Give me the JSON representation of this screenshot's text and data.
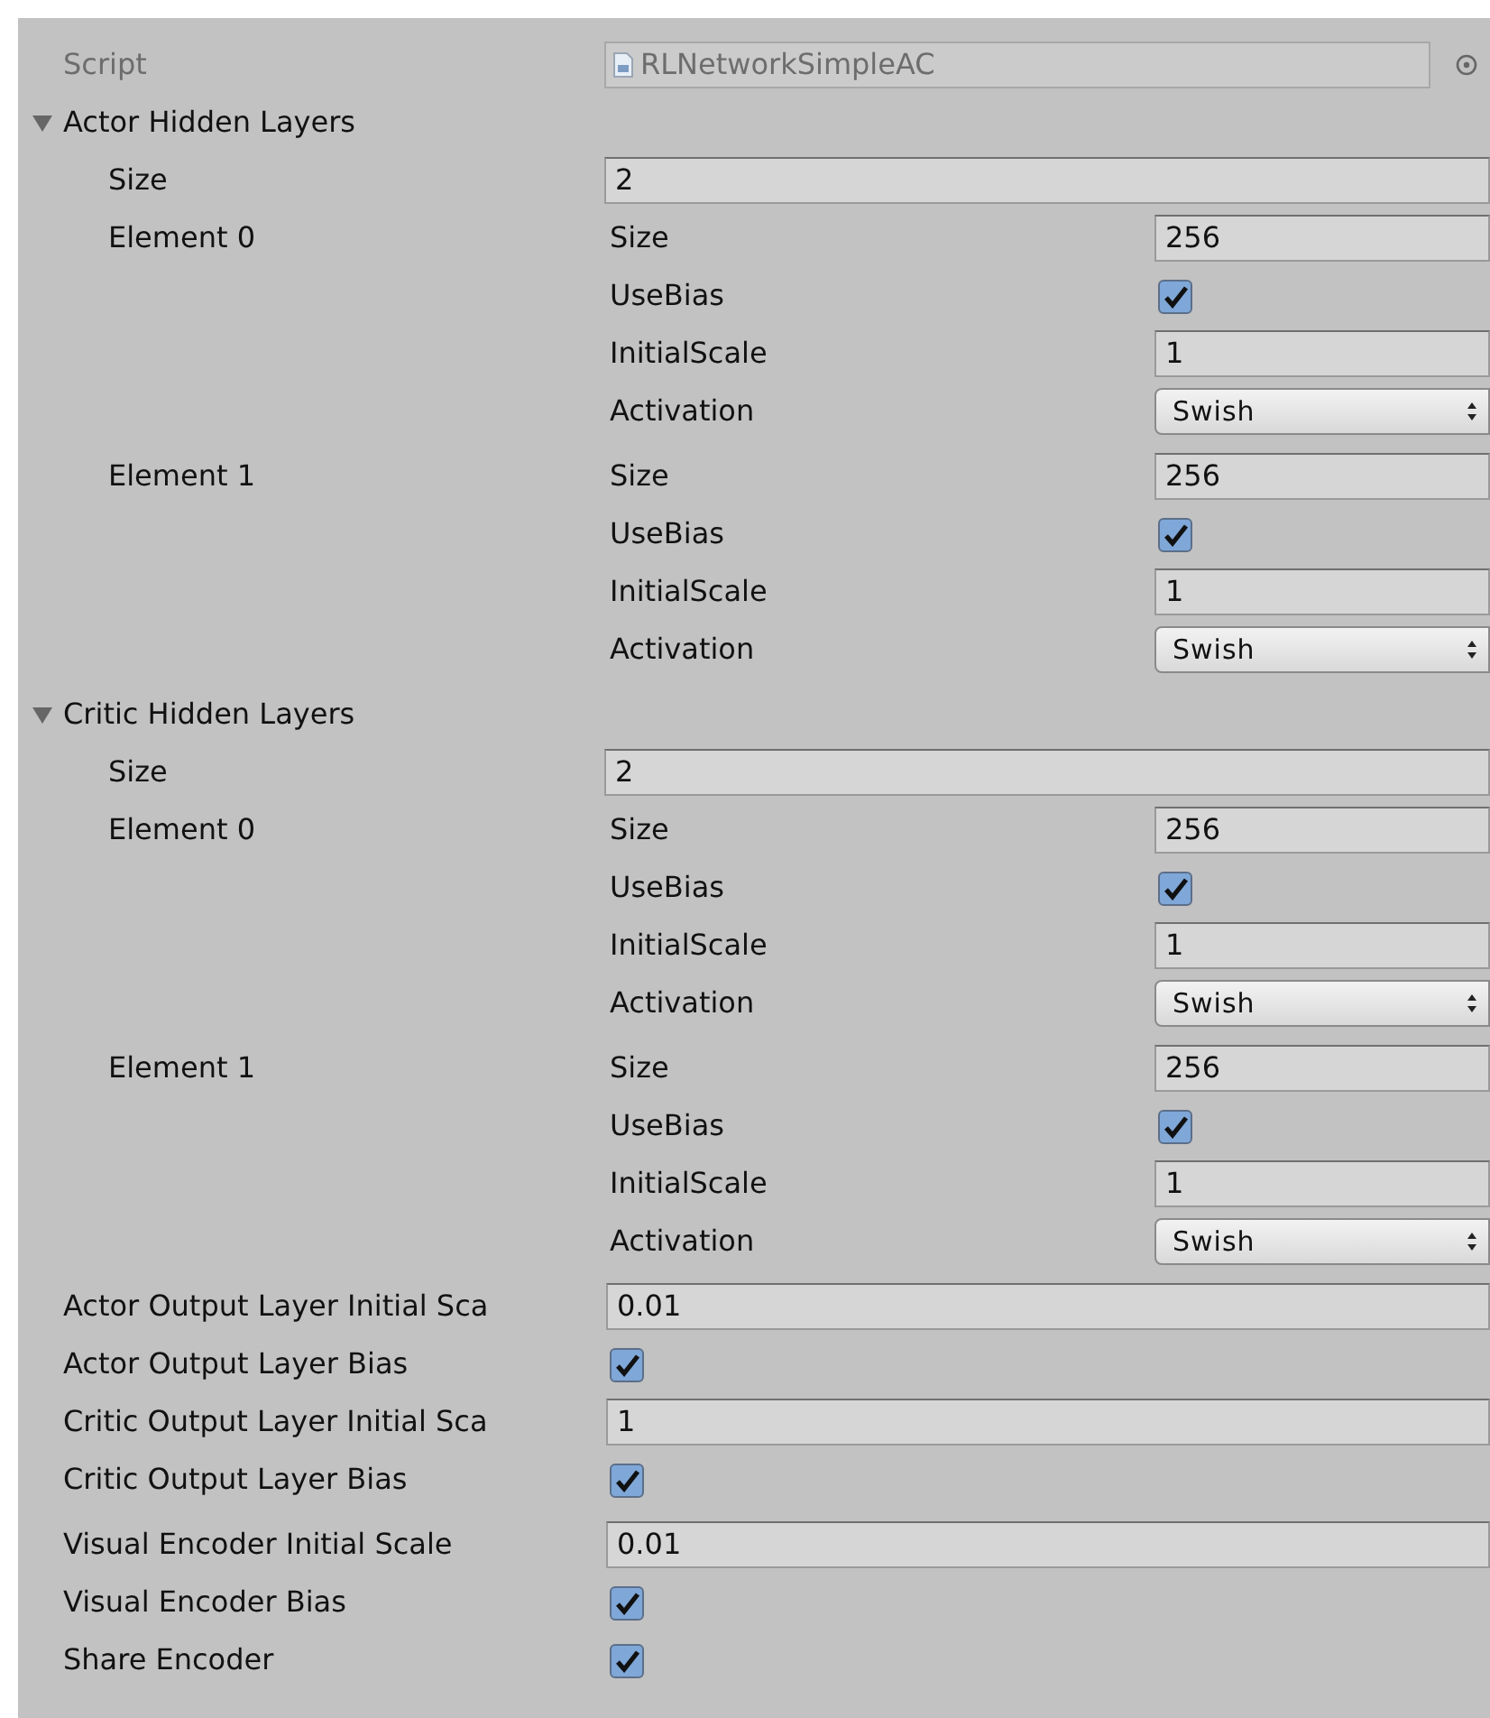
{
  "script": {
    "label": "Script",
    "value": "RLNetworkSimpleAC"
  },
  "sections": [
    {
      "title": "Actor Hidden Layers",
      "expanded": true,
      "size_label": "Size",
      "size": "2",
      "elements": [
        {
          "label": "Element 0",
          "fields": [
            {
              "kind": "number",
              "label": "Size",
              "value": "256"
            },
            {
              "kind": "checkbox",
              "label": "UseBias",
              "checked": true
            },
            {
              "kind": "number",
              "label": "InitialScale",
              "value": "1"
            },
            {
              "kind": "dropdown",
              "label": "Activation",
              "value": "Swish"
            }
          ]
        },
        {
          "label": "Element 1",
          "fields": [
            {
              "kind": "number",
              "label": "Size",
              "value": "256"
            },
            {
              "kind": "checkbox",
              "label": "UseBias",
              "checked": true
            },
            {
              "kind": "number",
              "label": "InitialScale",
              "value": "1"
            },
            {
              "kind": "dropdown",
              "label": "Activation",
              "value": "Swish"
            }
          ]
        }
      ]
    },
    {
      "title": "Critic Hidden Layers",
      "expanded": true,
      "size_label": "Size",
      "size": "2",
      "elements": [
        {
          "label": "Element 0",
          "fields": [
            {
              "kind": "number",
              "label": "Size",
              "value": "256"
            },
            {
              "kind": "checkbox",
              "label": "UseBias",
              "checked": true
            },
            {
              "kind": "number",
              "label": "InitialScale",
              "value": "1"
            },
            {
              "kind": "dropdown",
              "label": "Activation",
              "value": "Swish"
            }
          ]
        },
        {
          "label": "Element 1",
          "fields": [
            {
              "kind": "number",
              "label": "Size",
              "value": "256"
            },
            {
              "kind": "checkbox",
              "label": "UseBias",
              "checked": true
            },
            {
              "kind": "number",
              "label": "InitialScale",
              "value": "1"
            },
            {
              "kind": "dropdown",
              "label": "Activation",
              "value": "Swish"
            }
          ]
        }
      ]
    }
  ],
  "settings": [
    {
      "kind": "number",
      "label": "Actor Output Layer Initial Sca",
      "value": "0.01"
    },
    {
      "kind": "checkbox",
      "label": "Actor Output Layer Bias",
      "checked": true
    },
    {
      "kind": "number",
      "label": "Critic Output Layer Initial Sca",
      "value": "1"
    },
    {
      "kind": "checkbox",
      "label": "Critic Output Layer Bias",
      "checked": true
    },
    {
      "kind": "number",
      "label": "Visual Encoder Initial Scale",
      "value": "0.01"
    },
    {
      "kind": "checkbox",
      "label": "Visual Encoder Bias",
      "checked": true
    },
    {
      "kind": "checkbox",
      "label": "Share Encoder",
      "checked": true
    }
  ]
}
